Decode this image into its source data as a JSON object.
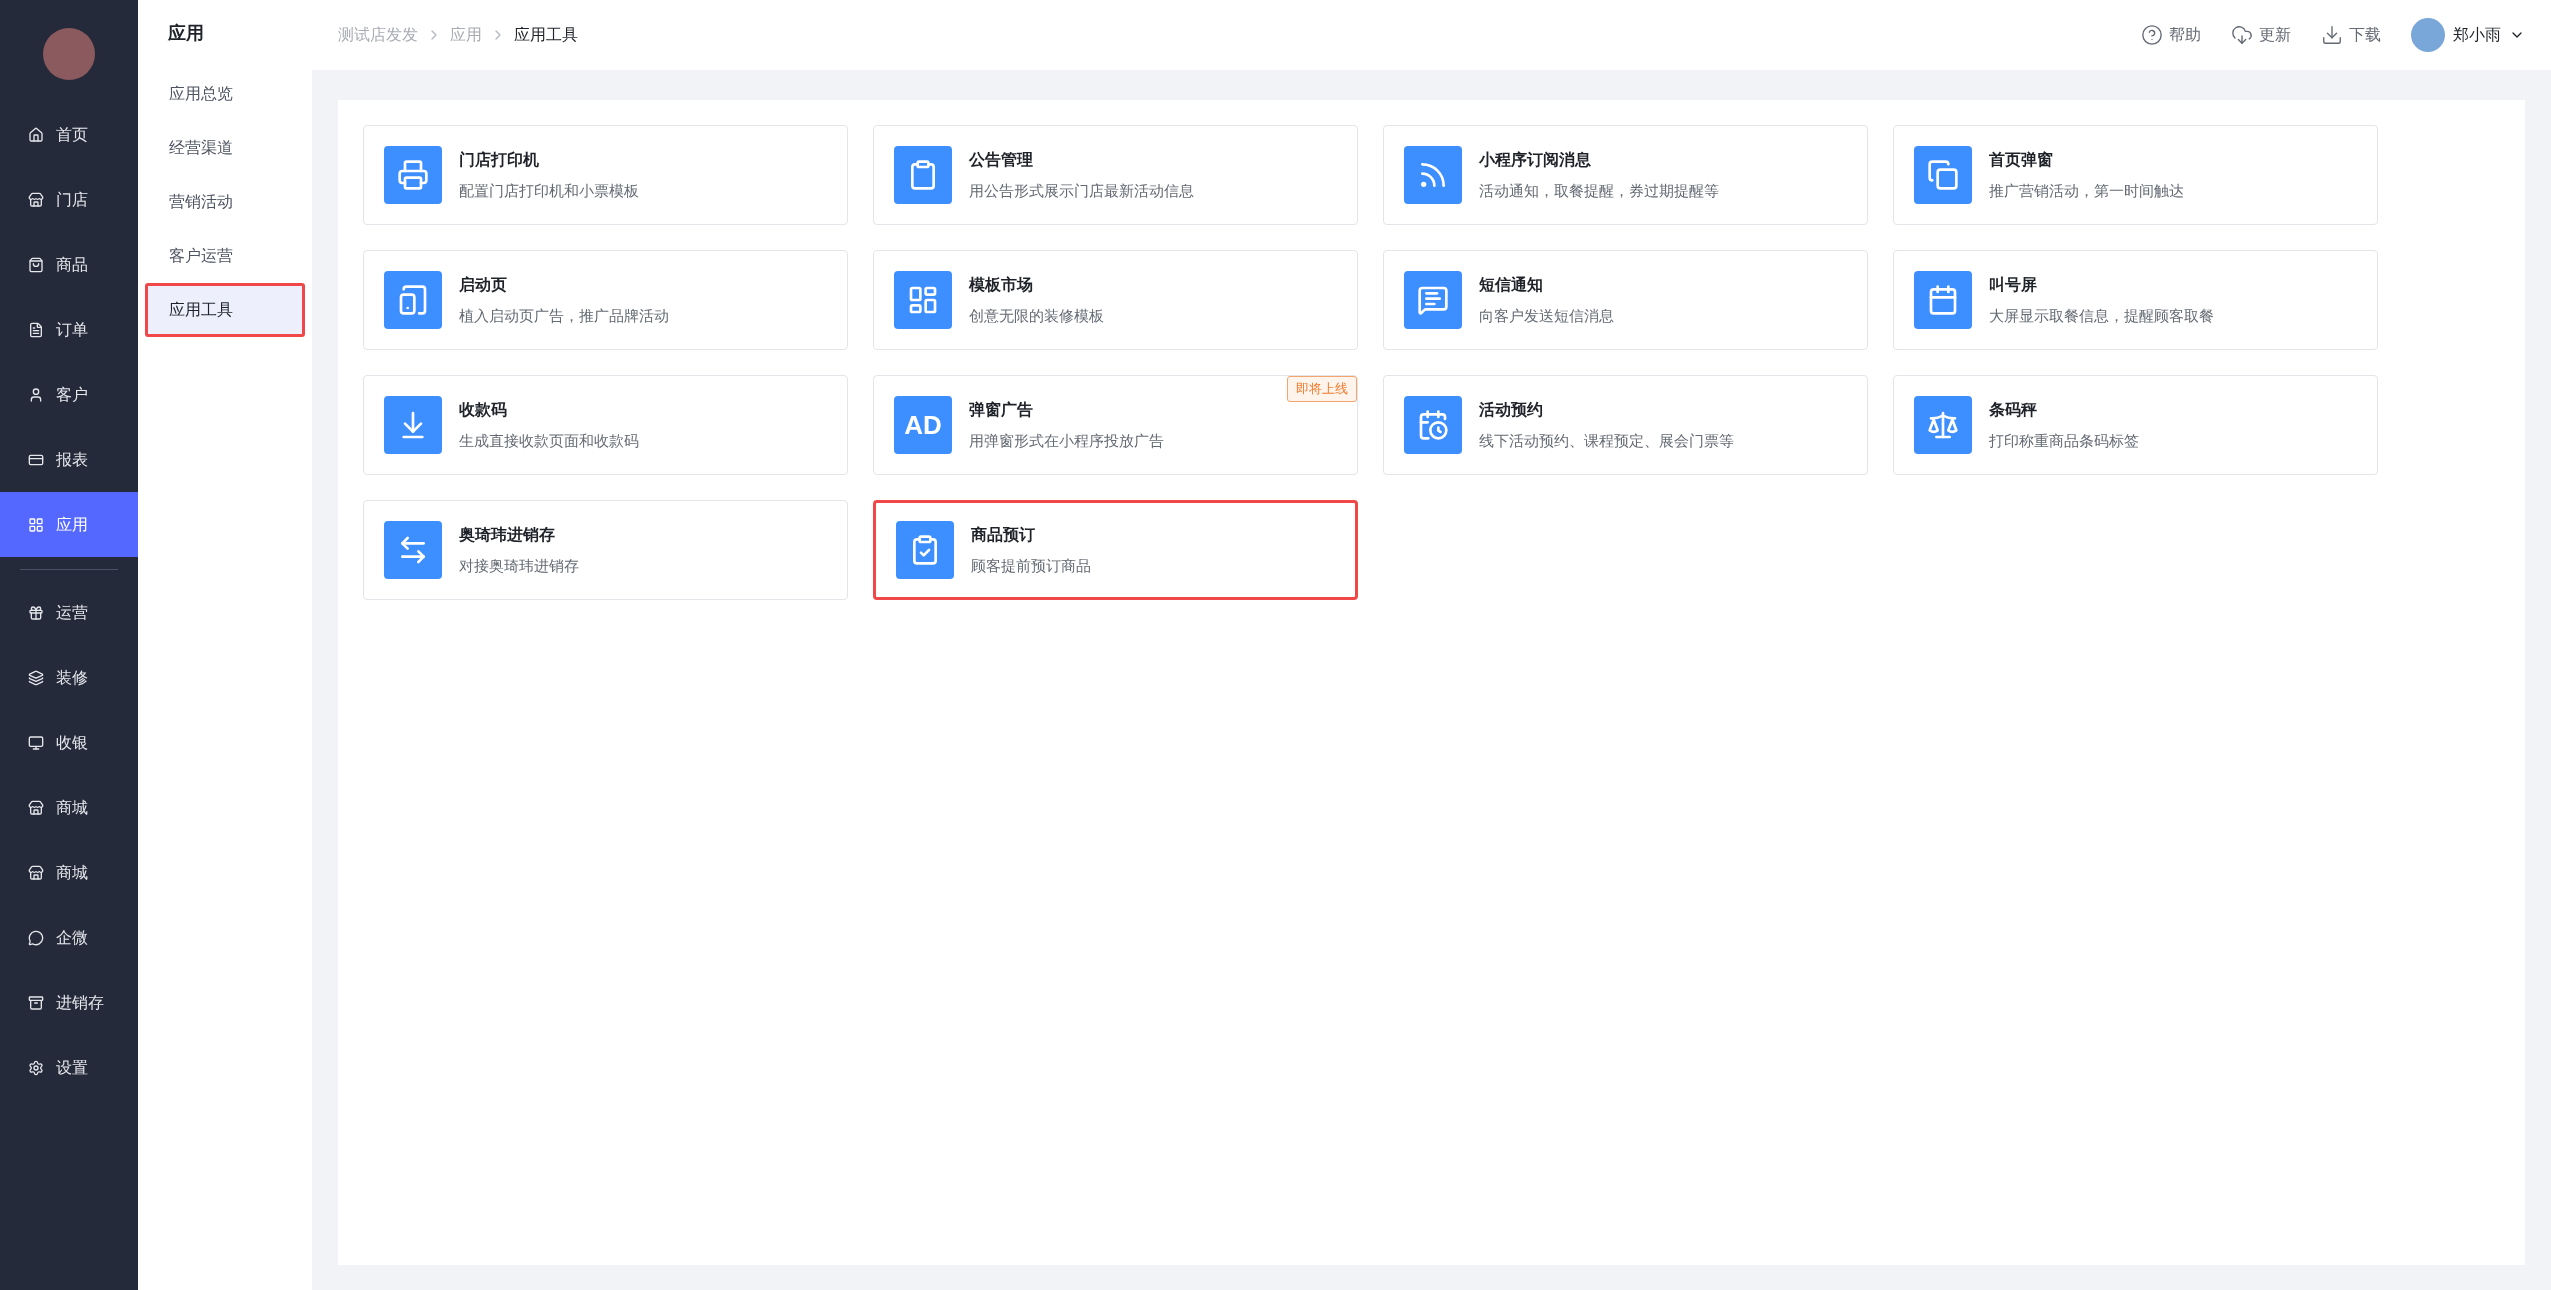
{
  "nav": {
    "groups": [
      [
        {
          "label": "首页",
          "selected": false
        },
        {
          "label": "门店",
          "selected": false
        },
        {
          "label": "商品",
          "selected": false
        },
        {
          "label": "订单",
          "selected": false
        },
        {
          "label": "客户",
          "selected": false
        },
        {
          "label": "报表",
          "selected": false
        },
        {
          "label": "应用",
          "selected": true
        }
      ],
      [
        {
          "label": "运营",
          "selected": false
        },
        {
          "label": "装修",
          "selected": false
        },
        {
          "label": "收银",
          "selected": false
        },
        {
          "label": "商城",
          "selected": false
        },
        {
          "label": "商城",
          "selected": false
        },
        {
          "label": "企微",
          "selected": false
        },
        {
          "label": "进销存",
          "selected": false
        },
        {
          "label": "设置",
          "selected": false
        }
      ]
    ]
  },
  "submenu": {
    "title": "应用",
    "items": [
      {
        "label": "应用总览",
        "selected": false,
        "highlighted": false
      },
      {
        "label": "经营渠道",
        "selected": false,
        "highlighted": false
      },
      {
        "label": "营销活动",
        "selected": false,
        "highlighted": false
      },
      {
        "label": "客户运营",
        "selected": false,
        "highlighted": false
      },
      {
        "label": "应用工具",
        "selected": true,
        "highlighted": true
      }
    ]
  },
  "breadcrumb": [
    "测试店发发",
    "应用",
    "应用工具"
  ],
  "toolbar": {
    "actions": [
      "帮助",
      "更新",
      "下载"
    ],
    "user": "郑小雨"
  },
  "cards": [
    {
      "title": "门店打印机",
      "description": "配置门店打印机和小票模板",
      "highlighted": false
    },
    {
      "title": "公告管理",
      "description": "用公告形式展示门店最新活动信息",
      "highlighted": false
    },
    {
      "title": "小程序订阅消息",
      "description": "活动通知，取餐提醒，券过期提醒等",
      "highlighted": false
    },
    {
      "title": "首页弹窗",
      "description": "推广营销活动，第一时间触达",
      "highlighted": false
    },
    {
      "title": "启动页",
      "description": "植入启动页广告，推广品牌活动",
      "highlighted": false
    },
    {
      "title": "模板市场",
      "description": "创意无限的装修模板",
      "highlighted": false
    },
    {
      "title": "短信通知",
      "description": "向客户发送短信消息",
      "highlighted": false
    },
    {
      "title": "叫号屏",
      "description": "大屏显示取餐信息，提醒顾客取餐",
      "highlighted": false
    },
    {
      "title": "收款码",
      "description": "生成直接收款页面和收款码",
      "highlighted": false
    },
    {
      "title": "弹窗广告",
      "description": "用弹窗形式在小程序投放广告",
      "highlighted": false,
      "badge": "即将上线",
      "icon_text": "AD"
    },
    {
      "title": "活动预约",
      "description": "线下活动预约、课程预定、展会门票等",
      "highlighted": false
    },
    {
      "title": "条码秤",
      "description": "打印称重商品条码标签",
      "highlighted": false
    },
    {
      "title": "奥琦玮进销存",
      "description": "对接奥琦玮进销存",
      "highlighted": false
    },
    {
      "title": "商品预订",
      "description": "顾客提前预订商品",
      "highlighted": true
    }
  ]
}
